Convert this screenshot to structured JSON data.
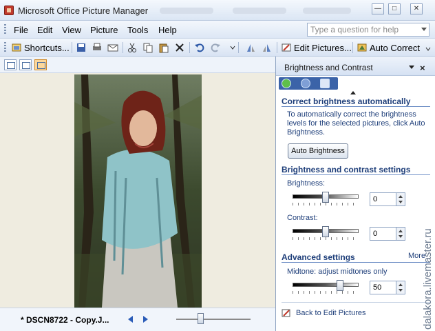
{
  "window": {
    "title": "Microsoft Office Picture Manager"
  },
  "menu": {
    "items": [
      "File",
      "Edit",
      "View",
      "Picture",
      "Tools",
      "Help"
    ],
    "ask_placeholder": "Type a question for help"
  },
  "toolbar": {
    "shortcuts_label": "Shortcuts...",
    "edit_pictures_label": "Edit Pictures...",
    "auto_correct_label": "Auto Correct"
  },
  "viewer": {
    "filename": "* DSCN8722 - Copy.J...",
    "zoom_level": 0.32
  },
  "task_pane": {
    "title": "Brightness and Contrast",
    "section_auto": {
      "title": "Correct brightness automatically",
      "description": "To automatically correct the brightness levels for the selected pictures, click Auto Brightness.",
      "button_label": "Auto Brightness"
    },
    "section_settings": {
      "title": "Brightness and contrast settings",
      "brightness_label": "Brightness:",
      "brightness_value": "0",
      "brightness_level": 0.5,
      "contrast_label": "Contrast:",
      "contrast_value": "0",
      "contrast_level": 0.5
    },
    "section_advanced": {
      "title": "Advanced settings",
      "more_label": "More",
      "midtone_label": "Midtone: adjust midtones only",
      "midtone_value": "50",
      "midtone_level": 0.72
    },
    "back_label": "Back to Edit Pictures"
  },
  "watermark": "dalakora.livemaster.ru",
  "colors": {
    "accent": "#1f3f7a",
    "nav_bar": "#3b63a8",
    "active_view": "#fcd79a"
  }
}
